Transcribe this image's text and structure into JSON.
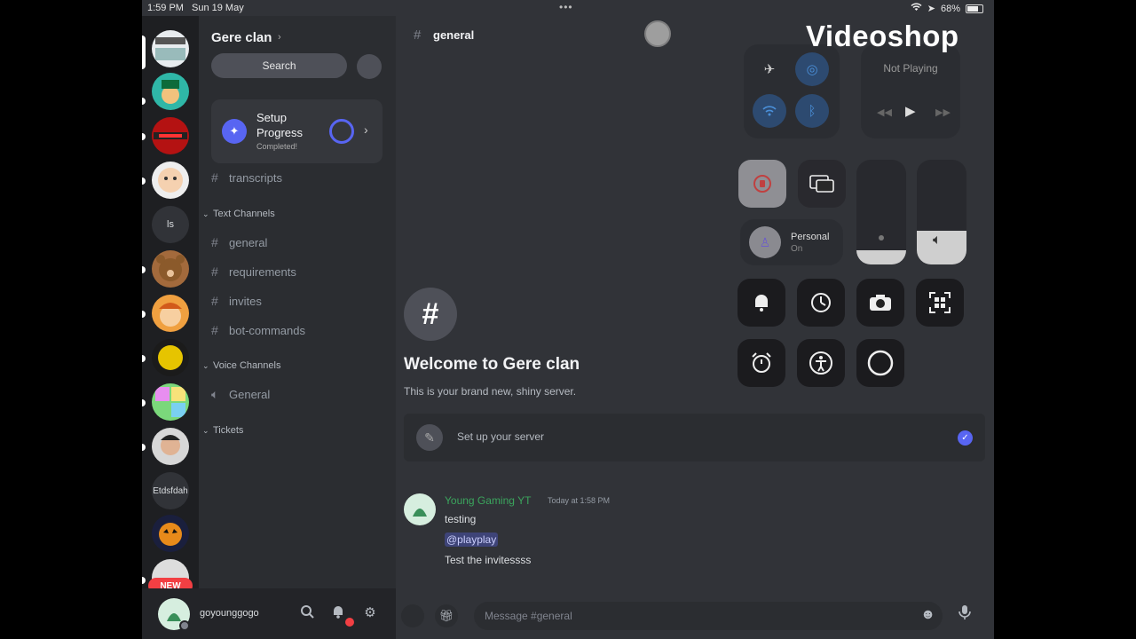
{
  "status_bar": {
    "time": "1:59 PM",
    "date": "Sun 19 May",
    "battery": "68%",
    "battery_level": 0.68
  },
  "watermark": "Videoshop",
  "rail": {
    "text_servers": [
      "ls",
      "Etdsfdah"
    ],
    "new_badge": "NEW"
  },
  "sidebar": {
    "server_name": "Gere clan",
    "server_chevron": "›",
    "search_label": "Search",
    "setup": {
      "title": "Setup Progress",
      "subtitle": "Completed!",
      "arrow": "›"
    },
    "loose_channel": "transcripts",
    "categories": {
      "text": "Text Channels",
      "voice": "Voice Channels",
      "tickets": "Tickets"
    },
    "text_channels": [
      "general",
      "requirements",
      "invites",
      "bot-commands"
    ],
    "voice_channels": [
      "General"
    ]
  },
  "user_panel": {
    "username": "goyounggogo"
  },
  "main": {
    "channel_name": "general",
    "welcome_title": "Welcome to Gere clan",
    "welcome_subtitle": "This is your brand new, shiny server.",
    "setup_row_label": "Set up your server",
    "message": {
      "author": "Young Gaming YT",
      "time": "Today at 1:58 PM",
      "lines": [
        "testing",
        "@playplay",
        "Test the invitessss"
      ]
    },
    "composer_placeholder": "Message #general"
  },
  "control_center": {
    "now_playing": "Not Playing",
    "focus_label": "Personal",
    "focus_state": "On"
  },
  "colors": {
    "accent": "#5865f2",
    "author_green": "#3ba55d",
    "danger": "#f23f43"
  }
}
